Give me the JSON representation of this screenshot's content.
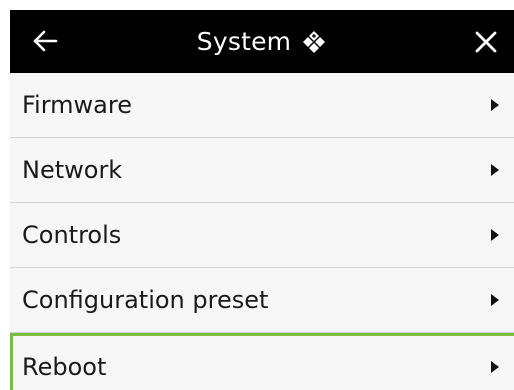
{
  "header": {
    "back_icon": "arrow-left-icon",
    "title": "System",
    "title_icon": "four-diamond-settings-icon",
    "close_icon": "close-icon",
    "background": "#000000",
    "text_color": "#ffffff"
  },
  "menu": {
    "items": [
      {
        "label": "Firmware",
        "icon": "triangle-right-icon",
        "selected": false
      },
      {
        "label": "Network",
        "icon": "triangle-right-icon",
        "selected": false
      },
      {
        "label": "Controls",
        "icon": "triangle-right-icon",
        "selected": false
      },
      {
        "label": "Configuration preset",
        "icon": "triangle-right-icon",
        "selected": false
      },
      {
        "label": "Reboot",
        "icon": "triangle-right-icon",
        "selected": true
      }
    ],
    "selection_color": "#7cbb3e",
    "item_background": "#f7f7f8"
  }
}
